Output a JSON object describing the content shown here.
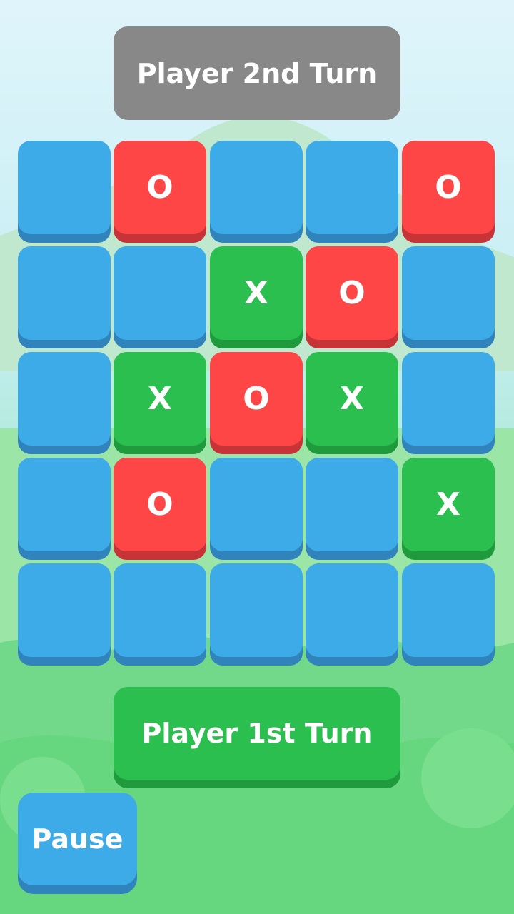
{
  "header": {
    "turn_label_p2": "Player 2nd Turn"
  },
  "footer": {
    "turn_label_p1": "Player 1st Turn",
    "pause_label": "Pause"
  },
  "board": {
    "rows": [
      [
        "",
        "O",
        "",
        "",
        "O"
      ],
      [
        "",
        "",
        "X",
        "O",
        ""
      ],
      [
        "",
        "X",
        "O",
        "X",
        ""
      ],
      [
        "",
        "O",
        "",
        "",
        "X"
      ],
      [
        "",
        "",
        "",
        "",
        ""
      ]
    ]
  },
  "colors": {
    "empty": "#3eabe9",
    "o_mark_tile": "#ff4647",
    "x_mark_tile": "#2bbf4f",
    "inactive_turn": "#888888",
    "active_turn": "#2bbf4f"
  }
}
